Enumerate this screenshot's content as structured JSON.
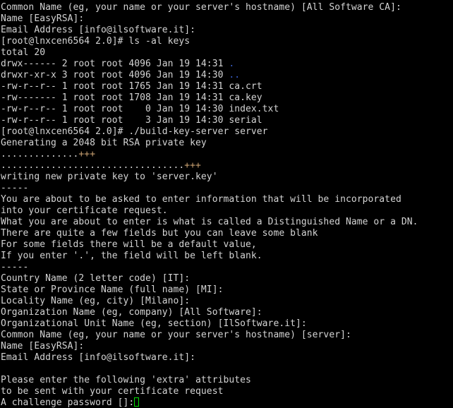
{
  "terminal": {
    "window_title": "root@lnxcen6564:~/easy-rsa/2.0",
    "background_color": "#000000",
    "foreground_color": "#d4d4d4",
    "dir_color": "#3a5fcd",
    "accent_color": "#c8a070",
    "cursor_color": "#00e000",
    "cursor_glyph": "block-outline-cursor",
    "columns": 79,
    "rows": 36,
    "prompt": "[root@lnxcen6564 2.0]#",
    "hostname": "lnxcen6564",
    "user": "root",
    "working_directory": "2.0"
  },
  "lines": [
    {
      "id": "l01",
      "segments": [
        {
          "text": "Common Name (eg, your name or your server's hostname) [All Software CA]:",
          "color": "default"
        }
      ]
    },
    {
      "id": "l02",
      "segments": [
        {
          "text": "Name [EasyRSA]:",
          "color": "default"
        }
      ]
    },
    {
      "id": "l03",
      "segments": [
        {
          "text": "Email Address [info@ilsoftware.it]:",
          "color": "default"
        }
      ]
    },
    {
      "id": "l04",
      "segments": [
        {
          "text": "[root@lnxcen6564 2.0]# ls -al keys",
          "color": "default"
        }
      ]
    },
    {
      "id": "l05",
      "segments": [
        {
          "text": "total 20",
          "color": "default"
        }
      ]
    },
    {
      "id": "l06",
      "segments": [
        {
          "text": "drwx------ 2 root root 4096 Jan 19 14:31 ",
          "color": "default"
        },
        {
          "text": ".",
          "color": "dir"
        }
      ]
    },
    {
      "id": "l07",
      "segments": [
        {
          "text": "drwxr-xr-x 3 root root 4096 Jan 19 14:30 ",
          "color": "default"
        },
        {
          "text": "..",
          "color": "dir"
        }
      ]
    },
    {
      "id": "l08",
      "segments": [
        {
          "text": "-rw-r--r-- 1 root root 1765 Jan 19 14:31 ca.crt",
          "color": "default"
        }
      ]
    },
    {
      "id": "l09",
      "segments": [
        {
          "text": "-rw------- 1 root root 1708 Jan 19 14:31 ca.key",
          "color": "default"
        }
      ]
    },
    {
      "id": "l10",
      "segments": [
        {
          "text": "-rw-r--r-- 1 root root    0 Jan 19 14:30 index.txt",
          "color": "default"
        }
      ]
    },
    {
      "id": "l11",
      "segments": [
        {
          "text": "-rw-r--r-- 1 root root    3 Jan 19 14:30 serial",
          "color": "default"
        }
      ]
    },
    {
      "id": "l12",
      "segments": [
        {
          "text": "[root@lnxcen6564 2.0]# ./build-key-server server",
          "color": "default"
        }
      ]
    },
    {
      "id": "l13",
      "segments": [
        {
          "text": "Generating a 2048 bit RSA private key",
          "color": "default"
        }
      ]
    },
    {
      "id": "l14",
      "segments": [
        {
          "text": "..............",
          "color": "default"
        },
        {
          "text": "+++",
          "color": "plus"
        }
      ]
    },
    {
      "id": "l15",
      "segments": [
        {
          "text": ".................................",
          "color": "default"
        },
        {
          "text": "+++",
          "color": "plus"
        }
      ]
    },
    {
      "id": "l16",
      "segments": [
        {
          "text": "writing new private key to 'server.key'",
          "color": "default"
        }
      ]
    },
    {
      "id": "l17",
      "segments": [
        {
          "text": "-----",
          "color": "default"
        }
      ]
    },
    {
      "id": "l18",
      "segments": [
        {
          "text": "You are about to be asked to enter information that will be incorporated",
          "color": "default"
        }
      ]
    },
    {
      "id": "l19",
      "segments": [
        {
          "text": "into your certificate request.",
          "color": "default"
        }
      ]
    },
    {
      "id": "l20",
      "segments": [
        {
          "text": "What you are about to enter is what is called a Distinguished Name or a DN.",
          "color": "default"
        }
      ]
    },
    {
      "id": "l21",
      "segments": [
        {
          "text": "There are quite a few fields but you can leave some blank",
          "color": "default"
        }
      ]
    },
    {
      "id": "l22",
      "segments": [
        {
          "text": "For some fields there will be a default value,",
          "color": "default"
        }
      ]
    },
    {
      "id": "l23",
      "segments": [
        {
          "text": "If you enter '.', the field will be left blank.",
          "color": "default"
        }
      ]
    },
    {
      "id": "l24",
      "segments": [
        {
          "text": "-----",
          "color": "default"
        }
      ]
    },
    {
      "id": "l25",
      "segments": [
        {
          "text": "Country Name (2 letter code) [IT]:",
          "color": "default"
        }
      ]
    },
    {
      "id": "l26",
      "segments": [
        {
          "text": "State or Province Name (full name) [MI]:",
          "color": "default"
        }
      ]
    },
    {
      "id": "l27",
      "segments": [
        {
          "text": "Locality Name (eg, city) [Milano]:",
          "color": "default"
        }
      ]
    },
    {
      "id": "l28",
      "segments": [
        {
          "text": "Organization Name (eg, company) [All Software]:",
          "color": "default"
        }
      ]
    },
    {
      "id": "l29",
      "segments": [
        {
          "text": "Organizational Unit Name (eg, section) [IlSoftware.it]:",
          "color": "default"
        }
      ]
    },
    {
      "id": "l30",
      "segments": [
        {
          "text": "Common Name (eg, your name or your server's hostname) [server]:",
          "color": "default"
        }
      ]
    },
    {
      "id": "l31",
      "segments": [
        {
          "text": "Name [EasyRSA]:",
          "color": "default"
        }
      ]
    },
    {
      "id": "l32",
      "segments": [
        {
          "text": "Email Address [info@ilsoftware.it]:",
          "color": "default"
        }
      ]
    },
    {
      "id": "l33",
      "segments": [
        {
          "text": "",
          "color": "default"
        }
      ]
    },
    {
      "id": "l34",
      "segments": [
        {
          "text": "Please enter the following 'extra' attributes",
          "color": "default"
        }
      ]
    },
    {
      "id": "l35",
      "segments": [
        {
          "text": "to be sent with your certificate request",
          "color": "default"
        }
      ]
    },
    {
      "id": "l36",
      "segments": [
        {
          "text": "A challenge password []:",
          "color": "default"
        }
      ],
      "cursor": true
    }
  ]
}
